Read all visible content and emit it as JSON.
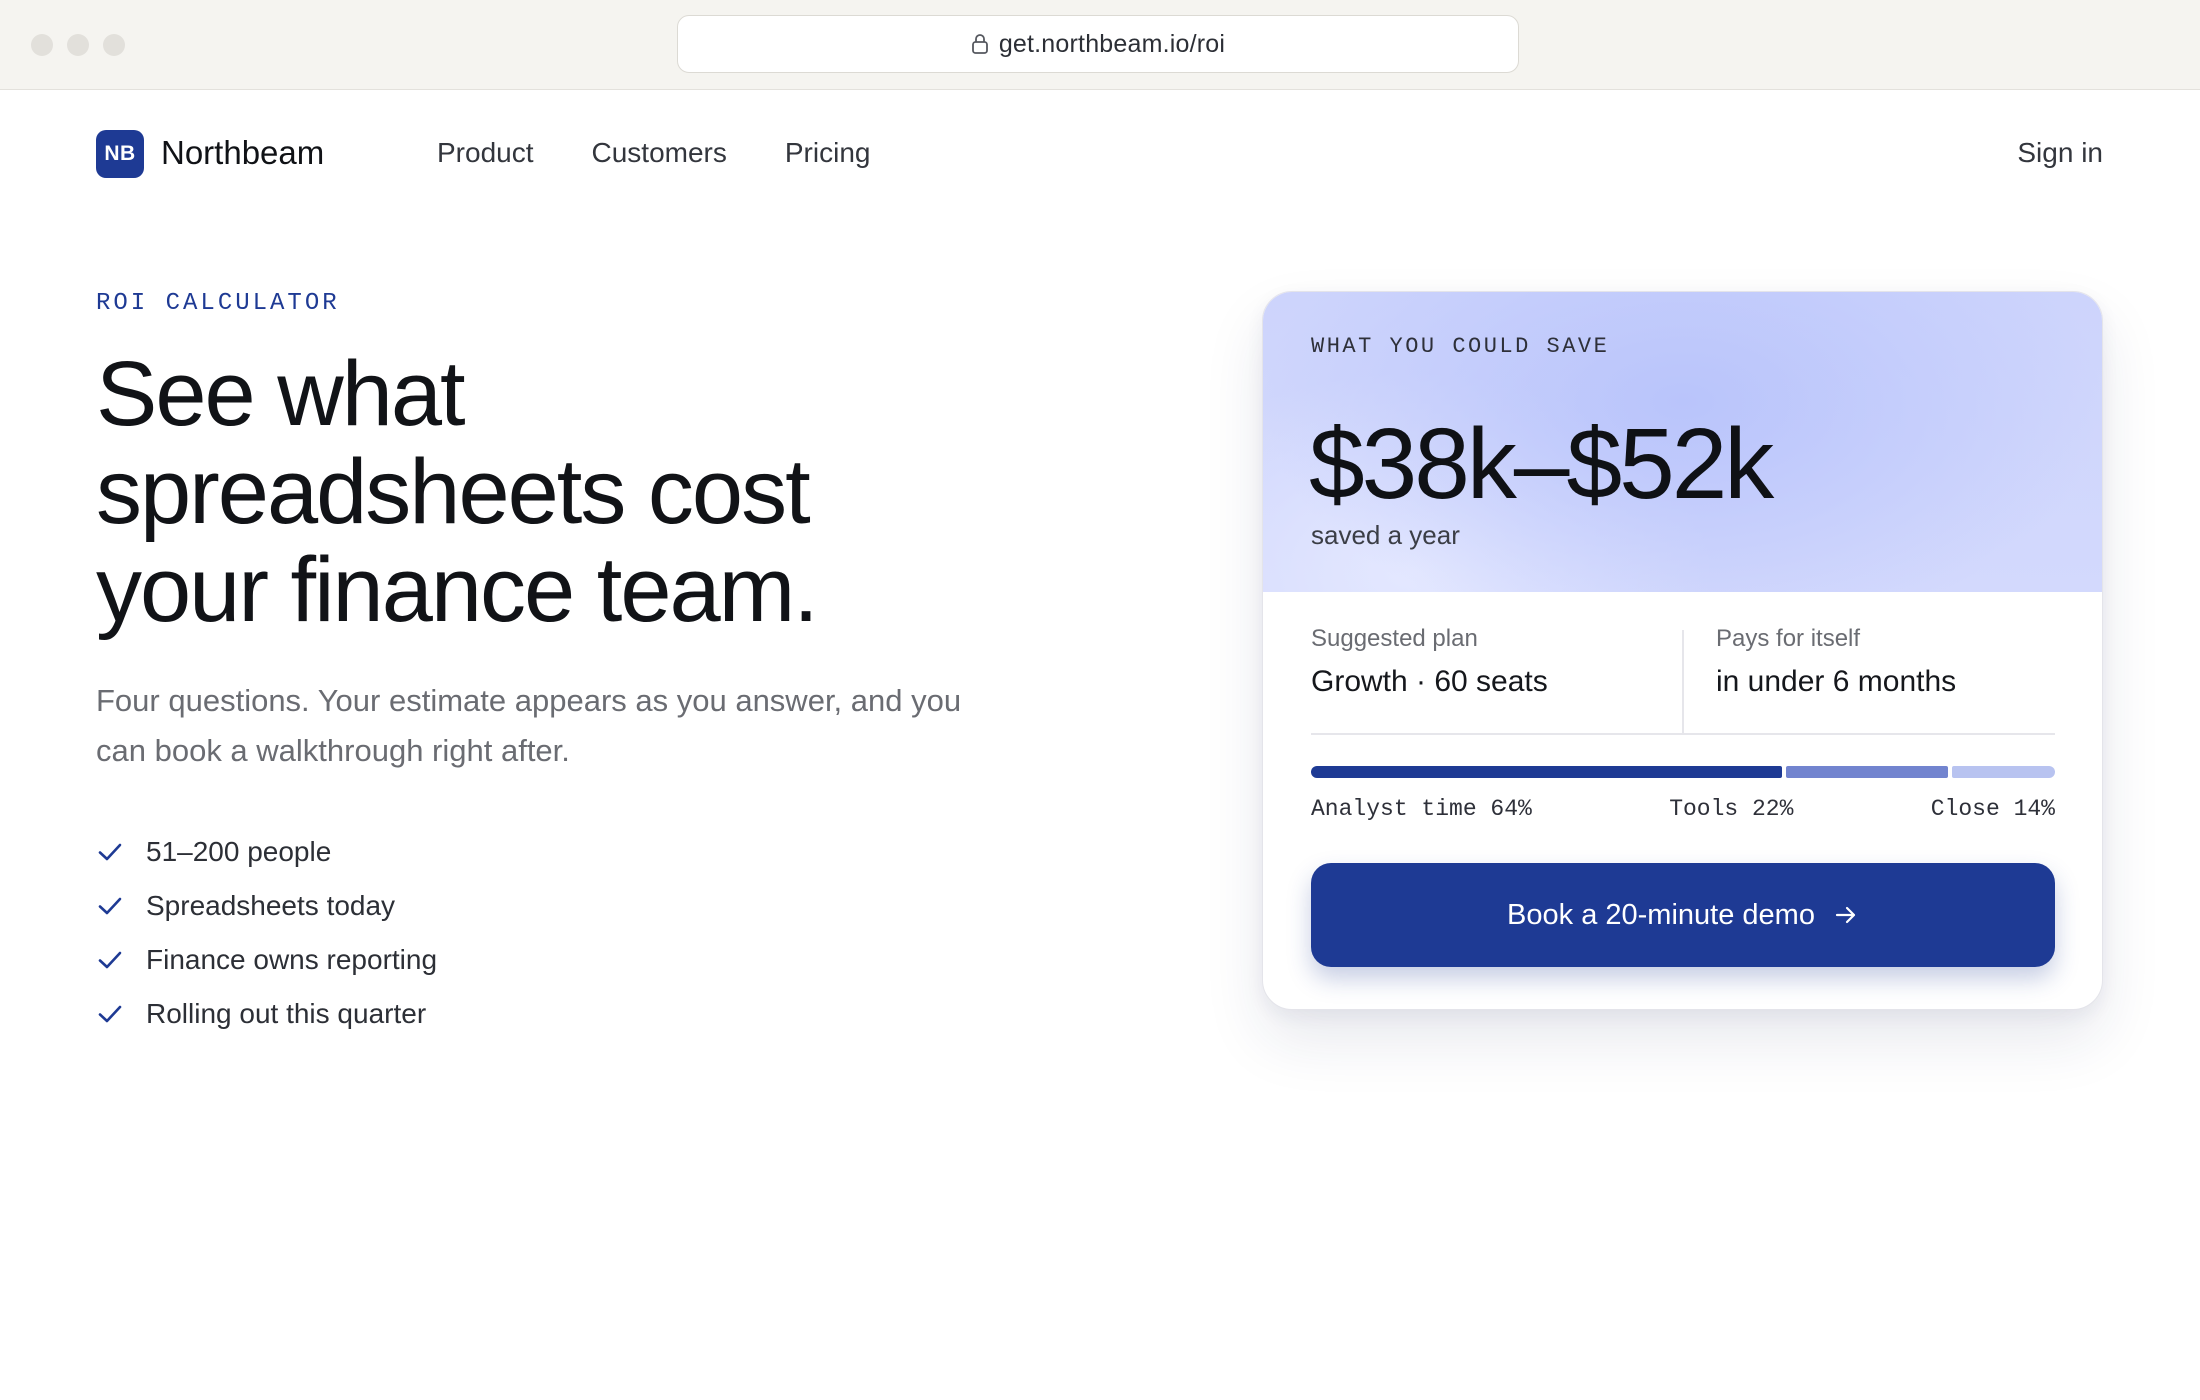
{
  "browser": {
    "url": "get.northbeam.io/roi",
    "lock_icon": "lock-icon"
  },
  "nav": {
    "logo_initials": "NB",
    "brand": "Northbeam",
    "links": [
      "Product",
      "Customers",
      "Pricing"
    ],
    "sign_in": "Sign in"
  },
  "hero": {
    "eyebrow": "ROI CALCULATOR",
    "headline_lines": [
      "See what",
      "spreadsheets cost",
      "your finance team."
    ],
    "subhead": "Four questions. Your estimate appears as you answer, and you can book a walkthrough right after.",
    "answers": [
      "51–200 people",
      "Spreadsheets today",
      "Finance owns reporting",
      "Rolling out this quarter"
    ],
    "check_icon": "check-icon"
  },
  "card": {
    "eyebrow": "WHAT YOU COULD SAVE",
    "savings_range": "$38k–$52k",
    "savings_caption": "saved a year",
    "plan_label": "Suggested plan",
    "plan_value": "Growth · 60 seats",
    "payback_label": "Pays for itself",
    "payback_value": "in under 6 months",
    "breakdown": [
      {
        "label": "Analyst time 64%",
        "share": 64,
        "color": "#1e3a94"
      },
      {
        "label": "Tools 22%",
        "share": 22,
        "color": "#7284cf"
      },
      {
        "label": "Close 14%",
        "share": 14,
        "color": "#b8c3f0"
      }
    ],
    "cta_label": "Book a 20-minute demo",
    "cta_icon": "arrow-right-icon"
  },
  "colors": {
    "brand": "#1e3a94",
    "card_gradient": "#cdd4fc"
  }
}
